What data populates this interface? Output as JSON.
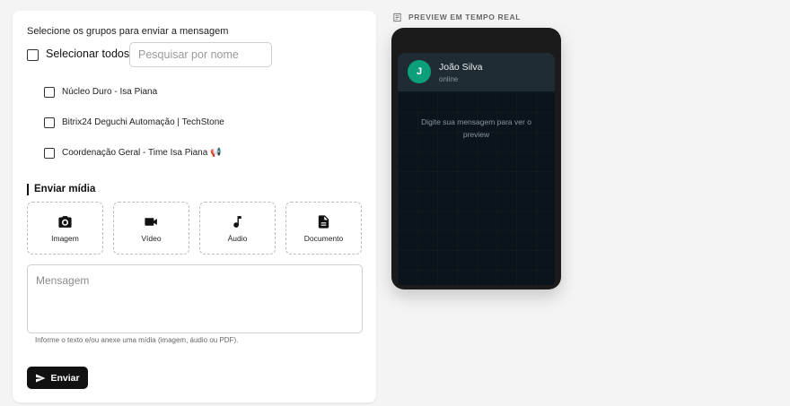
{
  "form": {
    "select_title": "Selecione os grupos para enviar a mensagem",
    "select_all_label": "Selecionar todos",
    "search_placeholder": "Pesquisar por nome",
    "groups": [
      {
        "label": "Núcleo Duro - Isa Piana",
        "checked": false
      },
      {
        "label": "Bitrix24 Deguchi Automação | TechStone",
        "checked": false
      },
      {
        "label": "Coordenação Geral - Time Isa Piana",
        "emoji": "📢",
        "checked": false
      }
    ]
  },
  "media": {
    "title": "Enviar mídia",
    "buttons": [
      {
        "label": "Imagem",
        "icon": "camera-icon"
      },
      {
        "label": "Vídeo",
        "icon": "video-camera-icon"
      },
      {
        "label": "Áudio",
        "icon": "music-note-icon"
      },
      {
        "label": "Documento",
        "icon": "document-icon"
      }
    ]
  },
  "message": {
    "placeholder": "Mensagem",
    "helper": "Informe o texto e/ou anexe uma mídia (imagem, áudio ou PDF).",
    "send_label": "Enviar"
  },
  "preview": {
    "title": "PREVIEW EM TEMPO REAL",
    "contact_initial": "J",
    "contact_name": "João Silva",
    "contact_status": "online",
    "empty_message": "Digite sua mensagem para ver o preview"
  },
  "colors": {
    "accent": "#111111",
    "avatar": "#0b9f7a",
    "chat_bg": "#0b141a",
    "chat_header": "#1f2c33"
  }
}
